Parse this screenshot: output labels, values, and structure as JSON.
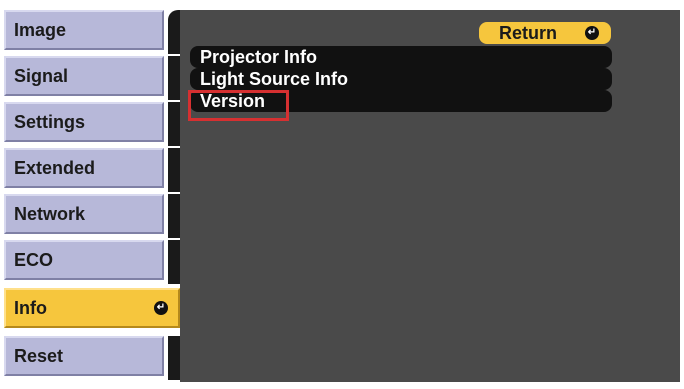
{
  "menu": {
    "items": [
      {
        "label": "Image"
      },
      {
        "label": "Signal"
      },
      {
        "label": "Settings"
      },
      {
        "label": "Extended"
      },
      {
        "label": "Network"
      },
      {
        "label": "ECO"
      },
      {
        "label": "Info",
        "selected": true
      },
      {
        "label": "Reset"
      }
    ],
    "enter_icon": "enter-icon"
  },
  "panel": {
    "return_label": "Return",
    "rows": [
      {
        "label": "Projector Info"
      },
      {
        "label": "Light Source Info"
      },
      {
        "label": "Version"
      }
    ],
    "highlighted": "Version"
  },
  "colors": {
    "menu_bg": "#b7b8d9",
    "selected_bg": "#f6c63d",
    "panel_bg": "#4a4a4a",
    "row_bg": "#111111",
    "highlight": "#d63031"
  }
}
